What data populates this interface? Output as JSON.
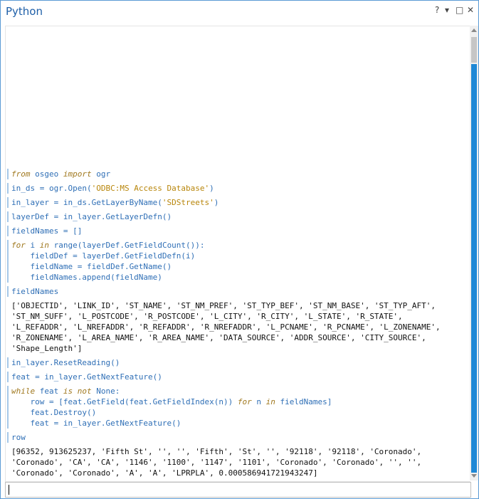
{
  "window": {
    "title": "Python",
    "help": "?",
    "menu": "▾",
    "maximize": "□",
    "close": "✕"
  },
  "cells": [
    {
      "kind": "in",
      "parts": [
        [
          "kw",
          "from"
        ],
        [
          "t",
          " osgeo "
        ],
        [
          "kw",
          "import"
        ],
        [
          "t",
          " ogr"
        ]
      ]
    },
    {
      "kind": "in",
      "parts": [
        [
          "t",
          "in_ds = ogr.Open("
        ],
        [
          "str",
          "'ODBC:MS Access Database'"
        ],
        [
          "t",
          ")"
        ]
      ]
    },
    {
      "kind": "in",
      "parts": [
        [
          "t",
          "in_layer = in_ds.GetLayerByName("
        ],
        [
          "str",
          "'SDStreets'"
        ],
        [
          "t",
          ")"
        ]
      ]
    },
    {
      "kind": "in",
      "parts": [
        [
          "t",
          "layerDef = in_layer.GetLayerDefn()"
        ]
      ]
    },
    {
      "kind": "in",
      "parts": [
        [
          "t",
          "fieldNames = []"
        ]
      ]
    },
    {
      "kind": "in",
      "parts": [
        [
          "kw",
          "for"
        ],
        [
          "t",
          " i "
        ],
        [
          "kw",
          "in"
        ],
        [
          "t",
          " range(layerDef.GetFieldCount()):\n    fieldDef = layerDef.GetFieldDefn(i)\n    fieldName = fieldDef.GetName()\n    fieldNames.append(fieldName)"
        ]
      ]
    },
    {
      "kind": "in",
      "parts": [
        [
          "t",
          "fieldNames"
        ]
      ]
    },
    {
      "kind": "out",
      "text": "['OBJECTID', 'LINK_ID', 'ST_NAME', 'ST_NM_PREF', 'ST_TYP_BEF', 'ST_NM_BASE', 'ST_TYP_AFT',\n'ST_NM_SUFF', 'L_POSTCODE', 'R_POSTCODE', 'L_CITY', 'R_CITY', 'L_STATE', 'R_STATE',\n'L_REFADDR', 'L_NREFADDR', 'R_REFADDR', 'R_NREFADDR', 'L_PCNAME', 'R_PCNAME', 'L_ZONENAME',\n'R_ZONENAME', 'L_AREA_NAME', 'R_AREA_NAME', 'DATA_SOURCE', 'ADDR_SOURCE', 'CITY_SOURCE',\n'Shape_Length']"
    },
    {
      "kind": "in",
      "parts": [
        [
          "t",
          "in_layer.ResetReading()"
        ]
      ]
    },
    {
      "kind": "in",
      "parts": [
        [
          "t",
          "feat = in_layer.GetNextFeature()"
        ]
      ]
    },
    {
      "kind": "in",
      "parts": [
        [
          "kw",
          "while"
        ],
        [
          "t",
          " feat "
        ],
        [
          "kw",
          "is not"
        ],
        [
          "t",
          " None:\n    row = [feat.GetField(feat.GetFieldIndex(n)) "
        ],
        [
          "kw",
          "for"
        ],
        [
          "t",
          " n "
        ],
        [
          "kw",
          "in"
        ],
        [
          "t",
          " fieldNames]\n    feat.Destroy()\n    feat = in_layer.GetNextFeature()"
        ]
      ]
    },
    {
      "kind": "in",
      "parts": [
        [
          "t",
          "row"
        ]
      ]
    },
    {
      "kind": "out",
      "text": "[96352, 913625237, 'Fifth St', '', '', 'Fifth', 'St', '', '92118', '92118', 'Coronado',\n'Coronado', 'CA', 'CA', '1146', '1100', '1147', '1101', 'Coronado', 'Coronado', '', '',\n'Coronado', 'Coronado', 'A', 'A', 'LPRPLA', 0.000586941721943247]"
    }
  ],
  "input": {
    "value": ""
  }
}
